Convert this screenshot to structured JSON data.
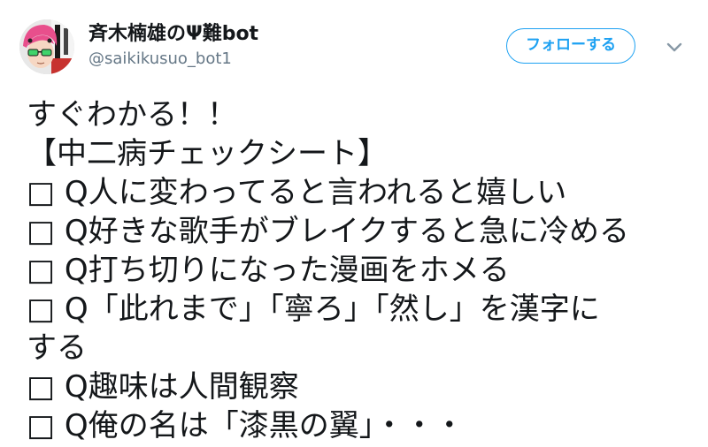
{
  "tweet": {
    "author": {
      "display_name": "斉木楠雄のΨ難bot",
      "handle": "@saikikusuo_bot1",
      "avatar_icon": "avatar-icon"
    },
    "follow_button_label": "フォローする",
    "more_icon": "chevron-down-icon",
    "text_lines": [
      "すぐわかる！！",
      "【中二病チェックシート】",
      "□ Q人に変わってると言われると嬉しい",
      "□ Q好きな歌手がブレイクすると急に冷める",
      "□ Q打ち切りになった漫画をホメる",
      "□ Q「此れまで」「寧ろ」「然し」を漢字に",
      "する",
      "□ Q趣味は人間観察",
      "□ Q俺の名は「漆黒の翼」・・・"
    ]
  },
  "colors": {
    "accent": "#1da1f2",
    "text": "#14171a",
    "secondary_text": "#657786",
    "border": "#ccd6dd"
  }
}
